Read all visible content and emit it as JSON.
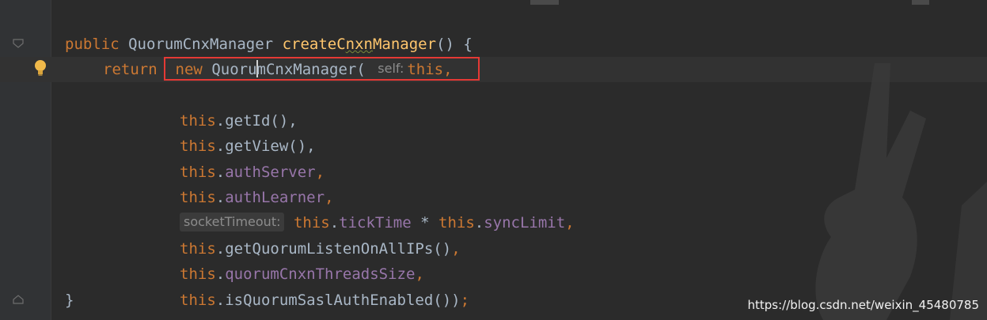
{
  "editor": {
    "lines": {
      "l1": {
        "kw_public": "public",
        "type": "QuorumCnxManager",
        "method_a": "createC",
        "method_b": "nxn",
        "method_c": "Manager",
        "tail": "() {"
      },
      "l2": {
        "kw_return": "return",
        "kw_new": "new",
        "cls_a": "Quoru",
        "cls_b": "mCnxManager",
        "paren": "(",
        "hint": "self:",
        "this": "this",
        "comma": ","
      },
      "l3": {
        "this": "this",
        "rest": ".getId(),"
      },
      "l4": {
        "this": "this",
        "rest": ".getView(),"
      },
      "l5": {
        "this": "this",
        "dot": ".",
        "field": "authServer",
        "comma": ","
      },
      "l6": {
        "this": "this",
        "dot": ".",
        "field": "authLearner",
        "comma": ","
      },
      "l7": {
        "hint": "socketTimeout:",
        "this1": "this",
        "dot1": ".",
        "field1": "tickTime",
        "op": " * ",
        "this2": "this",
        "dot2": ".",
        "field2": "syncLimit",
        "comma": ","
      },
      "l8": {
        "this": "this",
        "rest": ".getQuorumListenOnAllIPs()",
        "comma": ","
      },
      "l9": {
        "this": "this",
        "dot": ".",
        "field": "quorumCnxnThreadsSize",
        "comma": ","
      },
      "l10": {
        "this": "this",
        "rest": ".isQuorumSaslAuthEnabled())",
        "semi": ";"
      },
      "l11": {
        "brace": "}"
      }
    }
  },
  "icons": {
    "fold": "fold-icon",
    "bulb": "intention-bulb-icon"
  },
  "colors": {
    "keyword": "#cc7832",
    "method": "#ffc66d",
    "field": "#9876aa",
    "text": "#a9b7c6",
    "highlight": "#e53935"
  },
  "watermark": "https://blog.csdn.net/weixin_45480785"
}
